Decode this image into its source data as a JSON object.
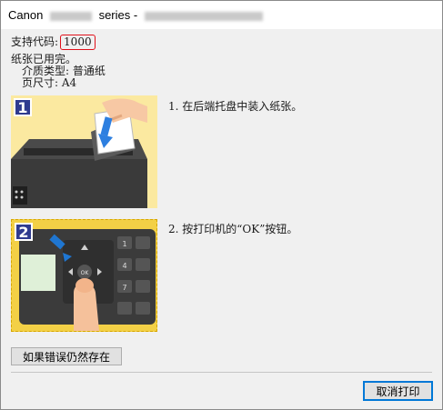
{
  "window": {
    "title_prefix": "Canon",
    "title_middle": "series -"
  },
  "support": {
    "label": "支持代码:",
    "code": "1000"
  },
  "status": {
    "message": "纸张已用完。",
    "media_type_label": "介质类型: 普通纸",
    "page_size_label": "页尺寸: A4"
  },
  "steps": [
    {
      "number": "1",
      "text": "1.  在后端托盘中装入纸张。"
    },
    {
      "number": "2",
      "text": "2.  按打印机的“OK”按钮。"
    }
  ],
  "buttons": {
    "persist_label": "如果错误仍然存在",
    "cancel_label": "取消打印"
  },
  "keypad_labels": [
    "1",
    "4",
    "7",
    "OK"
  ],
  "colors": {
    "badge": "#2f3b8f",
    "code_border": "#e0101a",
    "default_button_border": "#0078d7"
  }
}
